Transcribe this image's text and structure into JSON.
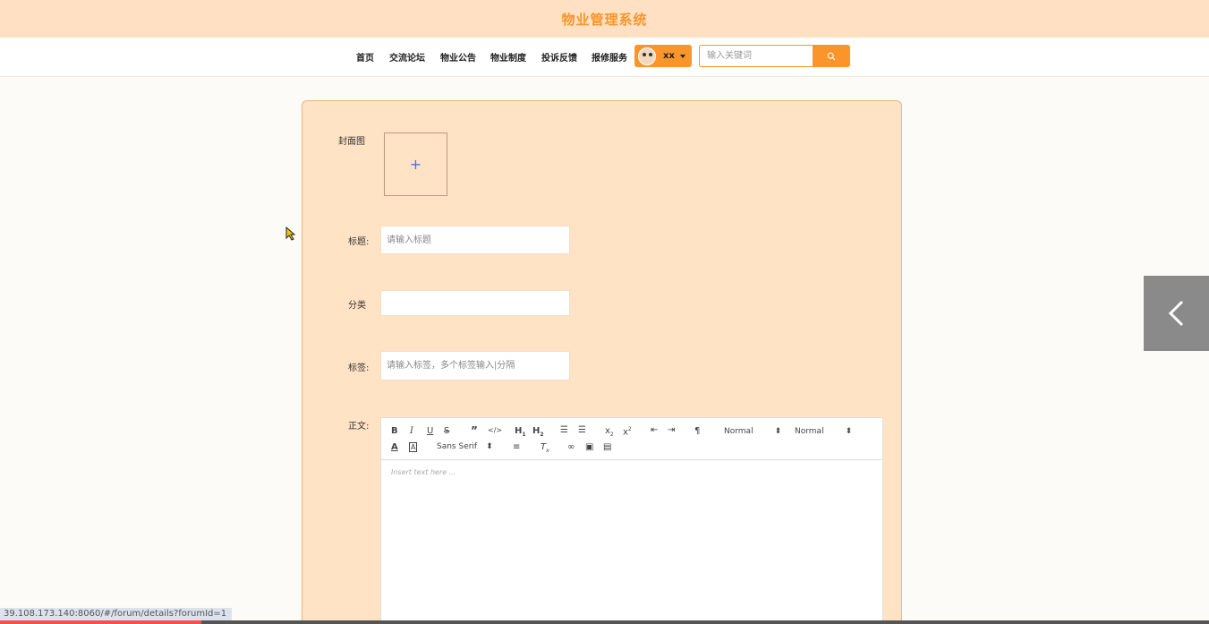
{
  "header": {
    "title": "物业管理系统"
  },
  "nav": {
    "items": [
      {
        "label": "首页"
      },
      {
        "label": "交流论坛"
      },
      {
        "label": "物业公告"
      },
      {
        "label": "物业制度"
      },
      {
        "label": "投诉反馈"
      },
      {
        "label": "报修服务"
      }
    ],
    "user": {
      "name": "xx"
    },
    "search": {
      "placeholder": "输入关键词",
      "icon": "search-icon"
    }
  },
  "form": {
    "cover": {
      "label": "封面图",
      "upload_symbol": "+"
    },
    "title": {
      "label": "标题:",
      "placeholder": "请输入标题"
    },
    "category": {
      "label": "分类",
      "value": ""
    },
    "tags": {
      "label": "标签:",
      "placeholder": "请输入标签，多个标签输入|分隔"
    },
    "content": {
      "label": "正文:",
      "editor_placeholder": "Insert text here ...",
      "toolbar": {
        "header_picker": "Normal",
        "size_picker": "Normal",
        "font_picker": "Sans Serif",
        "buttons": [
          "bold",
          "italic",
          "underline",
          "strike",
          "blockquote",
          "code-block",
          "h1",
          "h2",
          "ordered-list",
          "bullet-list",
          "subscript",
          "superscript",
          "outdent",
          "indent",
          "rtl",
          "color",
          "background",
          "align",
          "clean",
          "link",
          "image",
          "video"
        ]
      }
    }
  },
  "status_bar": {
    "url": "39.108.173.140:8060/#/forum/details?forumId=1"
  },
  "colors": {
    "accent": "#f9952a",
    "header_bg": "#ffe0c2",
    "panel_bg": "#ffe3c4",
    "panel_border": "#e7b57d"
  }
}
